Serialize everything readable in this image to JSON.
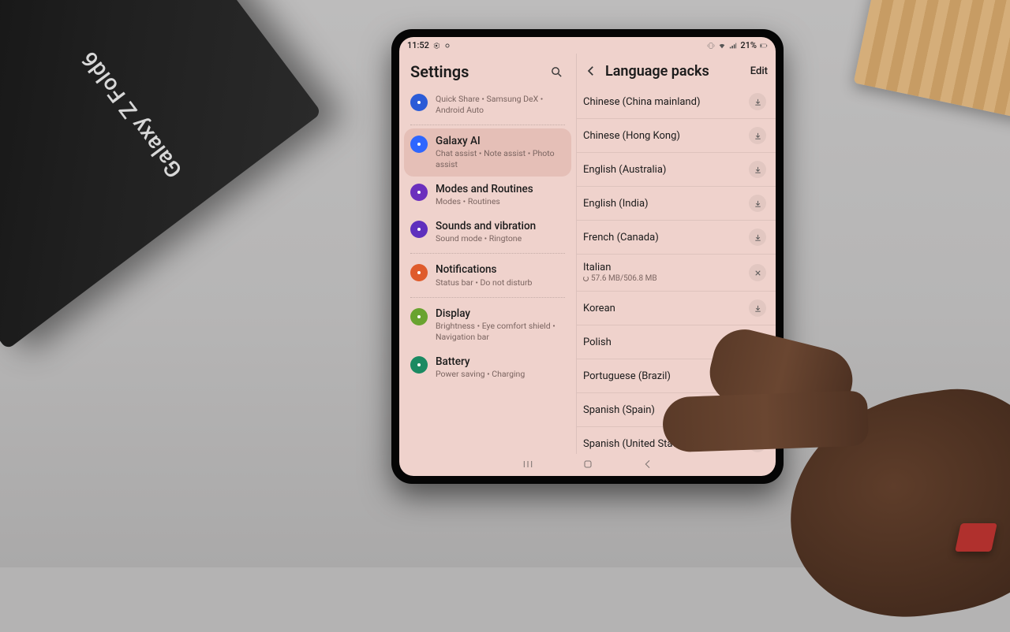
{
  "box_brand": "Galaxy Z Fold6",
  "status": {
    "time": "11:52",
    "battery": "21%"
  },
  "left": {
    "title": "Settings",
    "items": [
      {
        "title": "",
        "subtitle": "Quick Share  •  Samsung DeX  •  Android Auto",
        "color": "#2b5bd7"
      },
      {
        "title": "Galaxy AI",
        "subtitle": "Chat assist  •  Note assist  •  Photo assist",
        "color": "#2e66ff",
        "selected": true
      },
      {
        "title": "Modes and Routines",
        "subtitle": "Modes  •  Routines",
        "color": "#6b2fbd"
      },
      {
        "title": "Sounds and vibration",
        "subtitle": "Sound mode  •  Ringtone",
        "color": "#5e2fbd"
      },
      {
        "title": "Notifications",
        "subtitle": "Status bar  •  Do not disturb",
        "color": "#df5b2b"
      },
      {
        "title": "Display",
        "subtitle": "Brightness  •  Eye comfort shield  •  Navigation bar",
        "color": "#69a32f"
      },
      {
        "title": "Battery",
        "subtitle": "Power saving  •  Charging",
        "color": "#1a8a62"
      }
    ]
  },
  "right": {
    "title": "Language packs",
    "edit": "Edit",
    "langs": [
      {
        "name": "Chinese (China mainland)",
        "state": "download"
      },
      {
        "name": "Chinese (Hong Kong)",
        "state": "download"
      },
      {
        "name": "English (Australia)",
        "state": "download"
      },
      {
        "name": "English (India)",
        "state": "download"
      },
      {
        "name": "French (Canada)",
        "state": "download"
      },
      {
        "name": "Italian",
        "state": "progress",
        "progress": "57.6 MB/506.8 MB"
      },
      {
        "name": "Korean",
        "state": "download"
      },
      {
        "name": "Polish",
        "state": "download"
      },
      {
        "name": "Portuguese (Brazil)",
        "state": "download"
      },
      {
        "name": "Spanish (Spain)",
        "state": "download"
      },
      {
        "name": "Spanish (United States)",
        "state": "download"
      }
    ]
  }
}
